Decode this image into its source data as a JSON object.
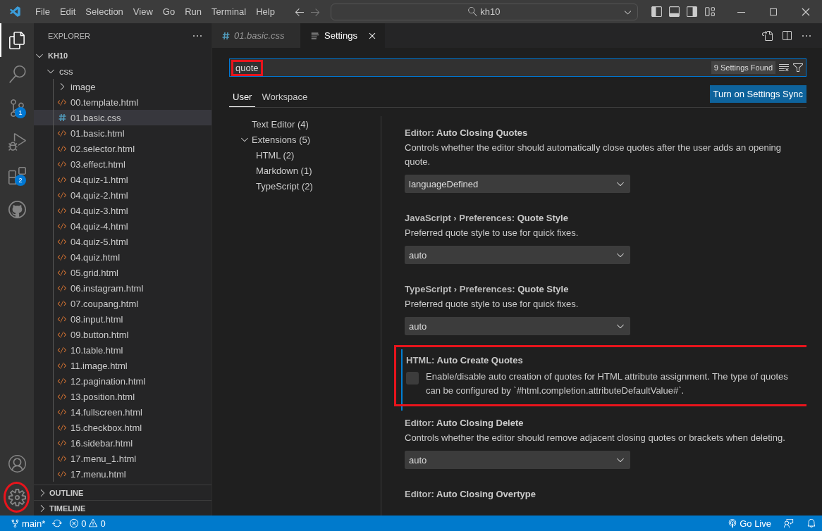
{
  "menu": [
    "File",
    "Edit",
    "Selection",
    "View",
    "Go",
    "Run",
    "Terminal",
    "Help"
  ],
  "command_center": {
    "value": "kh10"
  },
  "activity_bar": {
    "top": [
      {
        "selected": true
      },
      {
        "selected": false
      },
      {
        "selected": false,
        "badge": "1"
      },
      {
        "selected": false
      },
      {
        "selected": false,
        "badge": "2"
      },
      {
        "selected": false
      }
    ],
    "bottom": [
      {
        "highlighted": false
      },
      {
        "highlighted": true
      }
    ]
  },
  "sidebar": {
    "title": "EXPLORER",
    "root": "KH10",
    "expanded": true,
    "items": [
      {
        "kind": "folder",
        "name": "css",
        "expanded": true,
        "selected": false,
        "children": [
          {
            "kind": "folder",
            "name": "image",
            "expanded": false,
            "selected": false
          },
          {
            "kind": "html",
            "name": "00.template.html",
            "selected": false
          },
          {
            "kind": "css",
            "name": "01.basic.css",
            "selected": true
          },
          {
            "kind": "html",
            "name": "01.basic.html",
            "selected": false
          },
          {
            "kind": "html",
            "name": "02.selector.html",
            "selected": false
          },
          {
            "kind": "html",
            "name": "03.effect.html",
            "selected": false
          },
          {
            "kind": "html",
            "name": "04.quiz-1.html",
            "selected": false
          },
          {
            "kind": "html",
            "name": "04.quiz-2.html",
            "selected": false
          },
          {
            "kind": "html",
            "name": "04.quiz-3.html",
            "selected": false
          },
          {
            "kind": "html",
            "name": "04.quiz-4.html",
            "selected": false
          },
          {
            "kind": "html",
            "name": "04.quiz-5.html",
            "selected": false
          },
          {
            "kind": "html",
            "name": "04.quiz.html",
            "selected": false
          },
          {
            "kind": "html",
            "name": "05.grid.html",
            "selected": false
          },
          {
            "kind": "html",
            "name": "06.instagram.html",
            "selected": false
          },
          {
            "kind": "html",
            "name": "07.coupang.html",
            "selected": false
          },
          {
            "kind": "html",
            "name": "08.input.html",
            "selected": false
          },
          {
            "kind": "html",
            "name": "09.button.html",
            "selected": false
          },
          {
            "kind": "html",
            "name": "10.table.html",
            "selected": false
          },
          {
            "kind": "html",
            "name": "11.image.html",
            "selected": false
          },
          {
            "kind": "html",
            "name": "12.pagination.html",
            "selected": false
          },
          {
            "kind": "html",
            "name": "13.position.html",
            "selected": false
          },
          {
            "kind": "html",
            "name": "14.fullscreen.html",
            "selected": false
          },
          {
            "kind": "html",
            "name": "15.checkbox.html",
            "selected": false
          },
          {
            "kind": "html",
            "name": "16.sidebar.html",
            "selected": false
          },
          {
            "kind": "html",
            "name": "17.menu_1.html",
            "selected": false
          },
          {
            "kind": "html",
            "name": "17.menu.html",
            "selected": false
          }
        ]
      }
    ],
    "sections": [
      {
        "title": "OUTLINE",
        "expanded": false
      },
      {
        "title": "TIMELINE",
        "expanded": false
      }
    ]
  },
  "tabs": [
    {
      "kind": "css",
      "label": "01.basic.css",
      "selected": false,
      "preview": true
    },
    {
      "kind": "settings",
      "label": "Settings",
      "selected": true,
      "preview": false
    }
  ],
  "settings": {
    "search": {
      "value": "quote",
      "highlighted": true,
      "count": "9 Settings Found"
    },
    "scopes": [
      {
        "label": "User",
        "selected": true
      },
      {
        "label": "Workspace",
        "selected": false
      }
    ],
    "sync_button": "Turn on Settings Sync",
    "toc": [
      {
        "label": "Text Editor (4)"
      },
      {
        "label": "Extensions (5)",
        "expanded": true,
        "children": [
          {
            "label": "HTML (2)"
          },
          {
            "label": "Markdown (1)"
          },
          {
            "label": "TypeScript (2)"
          }
        ]
      }
    ],
    "items": [
      {
        "kind": "dropdown",
        "category": "Editor: ",
        "name": "Auto Closing Quotes",
        "description": "Controls whether the editor should automatically close quotes after the user adds an opening quote.",
        "value": "languageDefined",
        "focused": false,
        "highlighted": false
      },
      {
        "kind": "dropdown",
        "category": "JavaScript › Preferences: ",
        "name": "Quote Style",
        "description": "Preferred quote style to use for quick fixes.",
        "value": "auto",
        "focused": false,
        "highlighted": false
      },
      {
        "kind": "dropdown",
        "category": "TypeScript › Preferences: ",
        "name": "Quote Style",
        "description": "Preferred quote style to use for quick fixes.",
        "value": "auto",
        "focused": false,
        "highlighted": false
      },
      {
        "kind": "checkbox",
        "category": "HTML: ",
        "name": "Auto Create Quotes",
        "description": "Enable/disable auto creation of quotes for HTML attribute assignment. The type of quotes can be configured by `#html.completion.attributeDefaultValue#`.",
        "checked": false,
        "focused": true,
        "highlighted": true
      },
      {
        "kind": "dropdown",
        "category": "Editor: ",
        "name": "Auto Closing Delete",
        "description": "Controls whether the editor should remove adjacent closing quotes or brackets when deleting.",
        "value": "auto",
        "focused": false,
        "highlighted": false
      },
      {
        "kind": "title",
        "category": "Editor: ",
        "name": "Auto Closing Overtype",
        "focused": false,
        "highlighted": false
      }
    ]
  },
  "status_bar": {
    "branch": "main*",
    "errors": "0",
    "warnings": "0",
    "go_live": "Go Live"
  }
}
